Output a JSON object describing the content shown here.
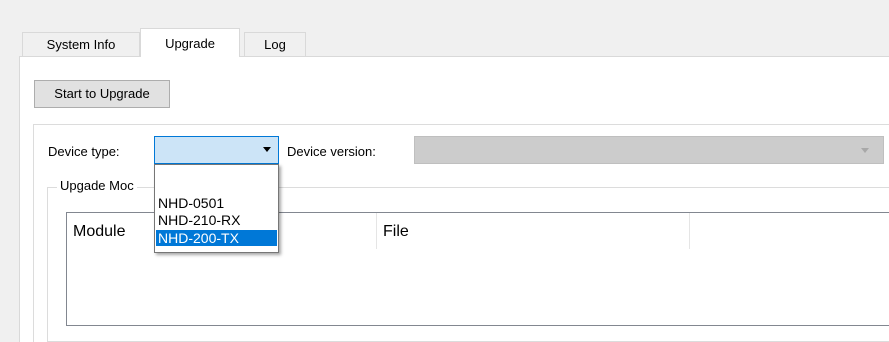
{
  "tabs": [
    {
      "label": "System Info"
    },
    {
      "label": "Upgrade"
    },
    {
      "label": "Log"
    }
  ],
  "active_tab": "Upgrade",
  "upgrade_button": {
    "label": "Start to Upgrade"
  },
  "device_type": {
    "label": "Device type:",
    "value": "",
    "options": [
      "NHD-0501",
      "NHD-210-RX",
      "NHD-200-TX"
    ],
    "highlighted_option": "NHD-200-TX"
  },
  "device_version": {
    "label": "Device version:",
    "value": "",
    "enabled": false
  },
  "upgrade_module_group": {
    "legend": "Upgade Moc",
    "columns": [
      "Module",
      "File",
      ""
    ]
  },
  "colors": {
    "accent": "#0078d7",
    "combo_focus_bg": "#cce4f7",
    "disabled_bg": "#cccccc"
  }
}
